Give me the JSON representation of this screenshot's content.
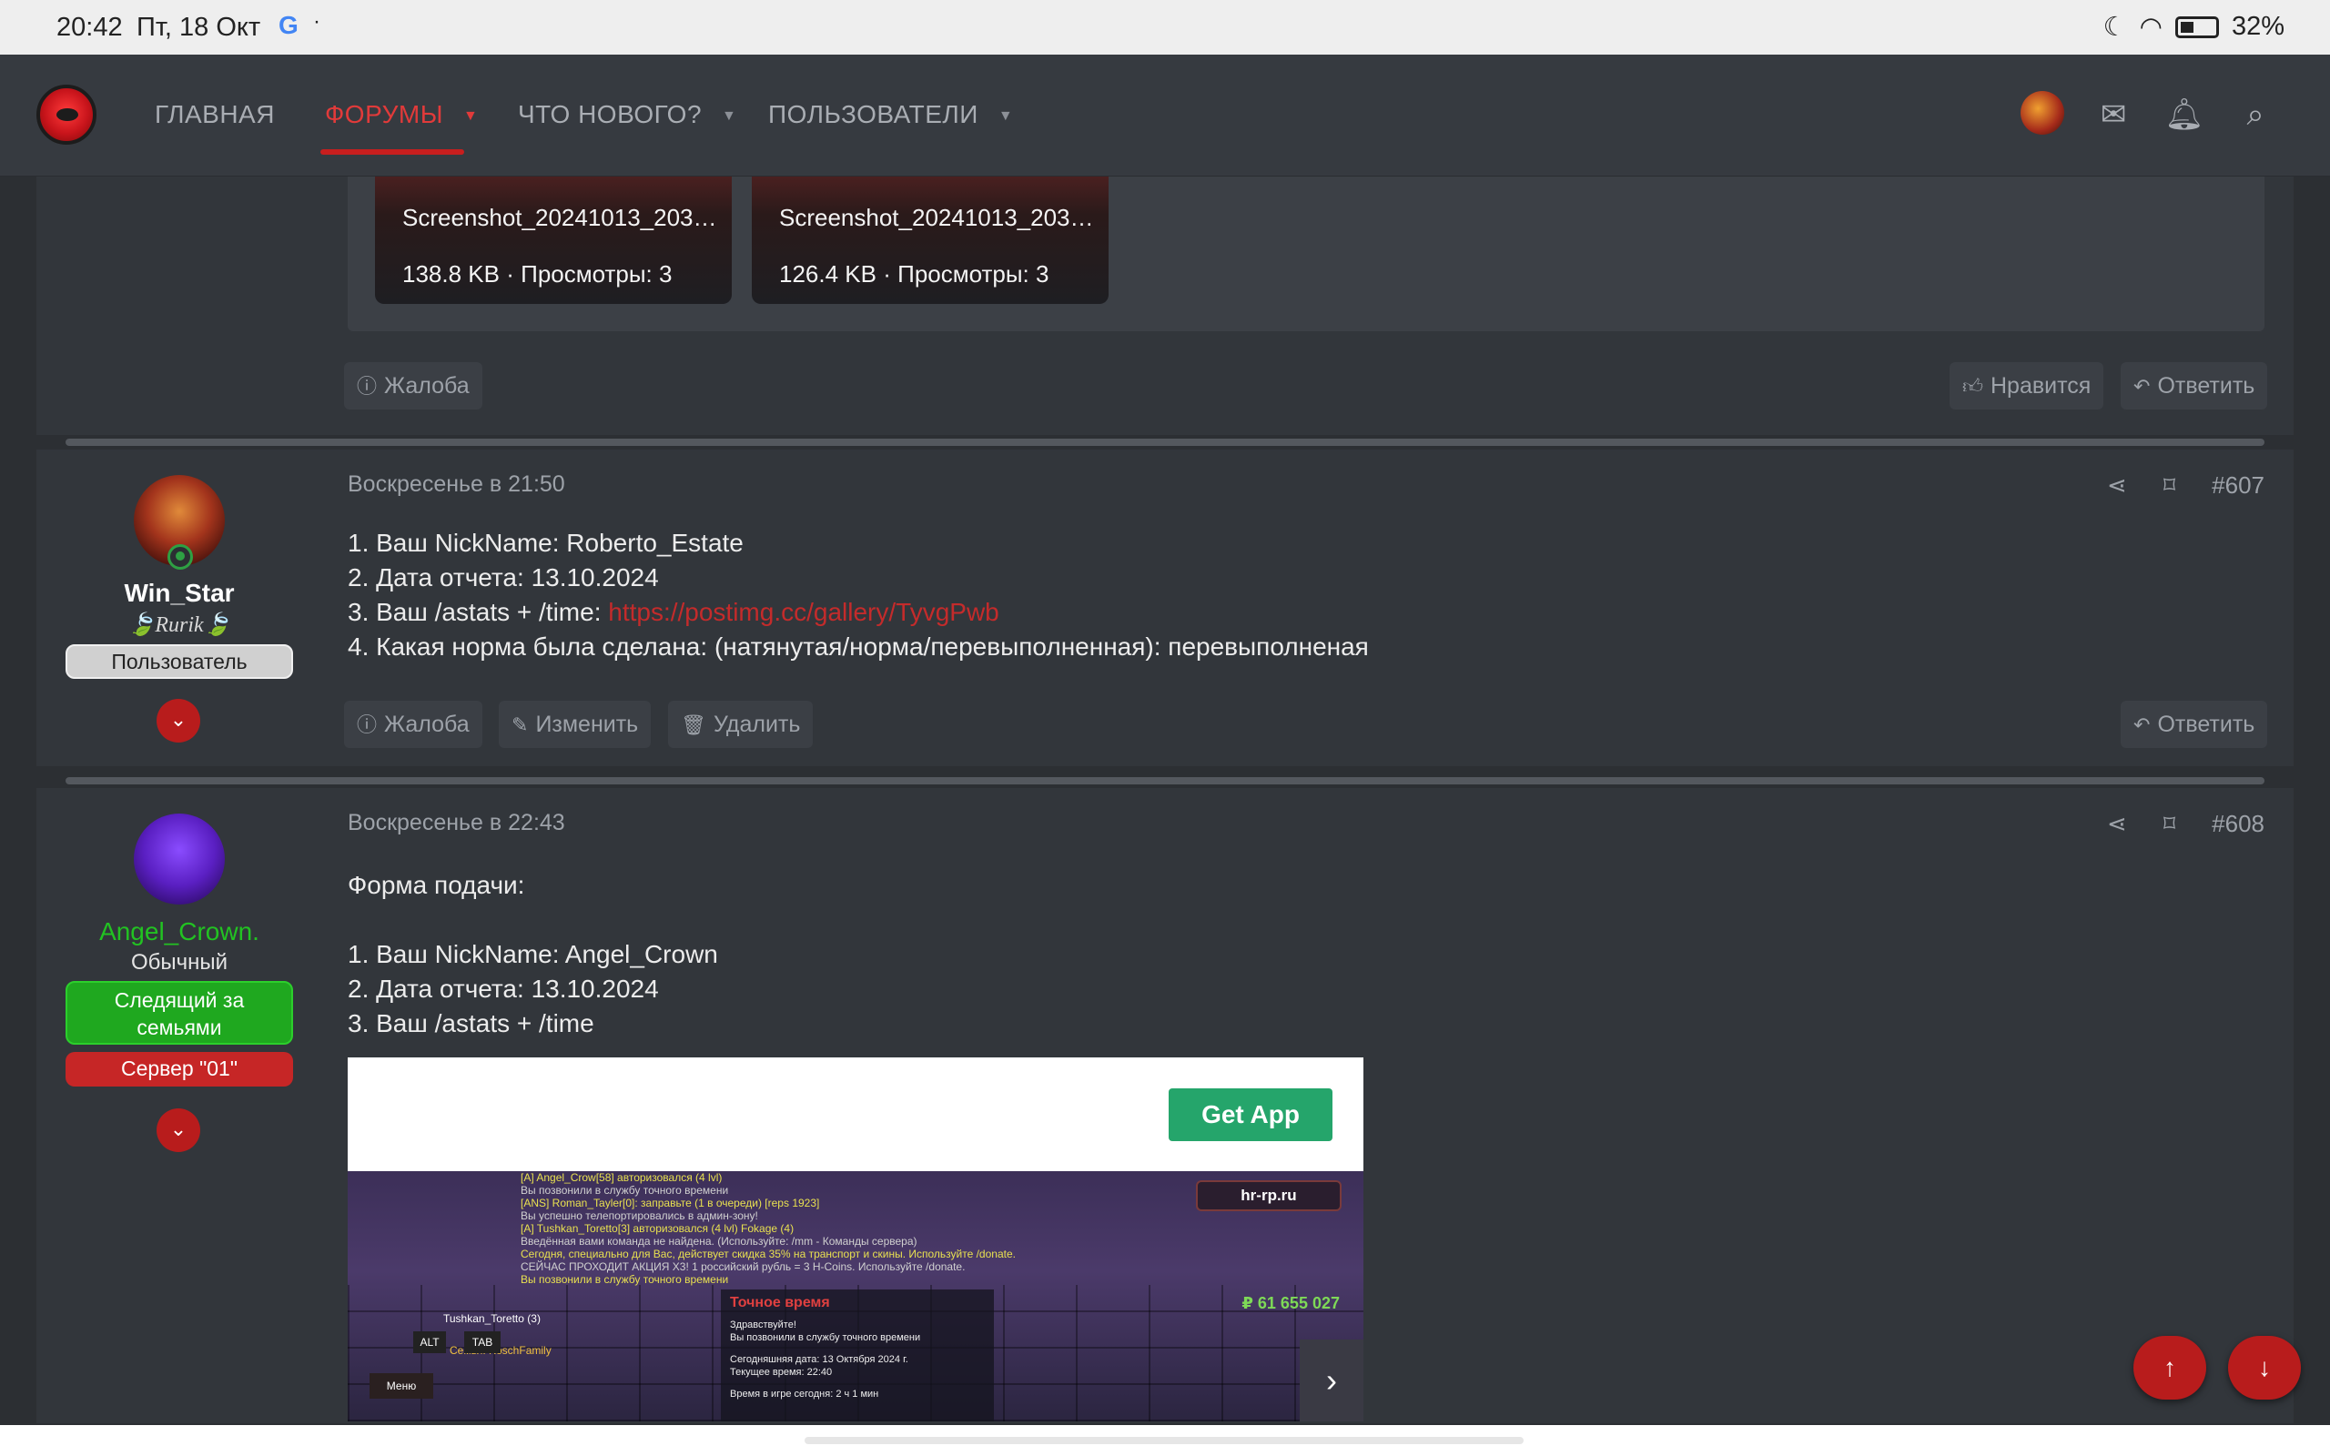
{
  "statusbar": {
    "time": "20:42",
    "date": "Пт, 18 Окт",
    "google_glyph": "G",
    "dot": "·",
    "battery": "32%"
  },
  "nav": {
    "items": [
      {
        "label": "ГЛАВНАЯ"
      },
      {
        "label": "ФОРУМЫ"
      },
      {
        "label": "ЧТО НОВОГО?"
      },
      {
        "label": "ПОЛЬЗОВАТЕЛИ"
      }
    ],
    "colors": {
      "accent": "#e13a3a",
      "bar": "#363a40"
    }
  },
  "prev_post": {
    "attachments": [
      {
        "name": "Screenshot_20241013_203…",
        "size": "138.8 KB",
        "sep": "·",
        "views": "Просмотры: 3"
      },
      {
        "name": "Screenshot_20241013_203…",
        "size": "126.4 KB",
        "sep": "·",
        "views": "Просмотры: 3"
      }
    ],
    "report": "Жалоба",
    "like": "Нравится",
    "reply": "Ответить"
  },
  "post607": {
    "user": {
      "name": "Win_Star",
      "title": "🍃Rurik🍃",
      "badge": "Пользователь"
    },
    "date": "Воскресенье в 21:50",
    "number": "#607",
    "lines": [
      "1. Ваш NickName: Roberto_Estate",
      "2. Дата отчета: 13.10.2024",
      "3. Ваш /astats + /time: ",
      "4. Какая норма была сделана: (натянутая/норма/перевыполненная): перевыполненая"
    ],
    "link": "https://postimg.cc/gallery/TyvgPwb",
    "report": "Жалоба",
    "edit": "Изменить",
    "delete": "Удалить",
    "reply": "Ответить"
  },
  "post608": {
    "user": {
      "name": "Angel_Crown.",
      "title": "Обычный",
      "badge1": "Следящий за семьями",
      "badge2": "Сервер \"01\""
    },
    "date": "Воскресенье в 22:43",
    "number": "#608",
    "lines": [
      "Форма подачи:",
      "",
      "1. Ваш NickName: Angel_Crown",
      "2. Дата отчета: 13.10.2024",
      "3. Ваш /astats + /time"
    ],
    "embed": {
      "button": "Get App",
      "hud_site": "hr-rp.ru",
      "money": "₽ 61 655 027",
      "chat": [
        "[A] Angel_Crow[58] авторизовался (4 lvl)",
        "Вы позвонили в службу точного времени",
        "[ANS] Roman_Tayler[0]: заправьте (1 в очереди) [reps 1923]",
        "Вы успешно телепортировались в админ-зону!",
        "[A] Tushkan_Toretto[3] авторизовался (4 lvl) Fokage (4)",
        "Введённая вами команда не найдена. (Используйте: /mm - Команды сервера)",
        "Сегодня, специально для Вас, действует скидка 35% на транспорт и скины. Используйте /donate.",
        "СЕЙЧАС ПРОХОДИТ АКЦИЯ Х3! 1 российский рубль = 3 H-Coins. Используйте /donate.",
        "Вы позвонили в службу точного времени"
      ],
      "dialog_title": "Точное время",
      "dialog_lines": [
        "Здравствуйте!",
        "Вы позвонили в службу точного времени",
        "",
        "Сегодняшняя дата: 13 Октября 2024 г.",
        "Текущее время: 22:40",
        "",
        "Время в игре сегодня: 2 ч 1 мин"
      ],
      "player": "Tushkan_Toretto (3)",
      "family": "Семья: KoschFamily",
      "menu": "Меню",
      "alt": "ALT",
      "tab": "TAB"
    }
  }
}
